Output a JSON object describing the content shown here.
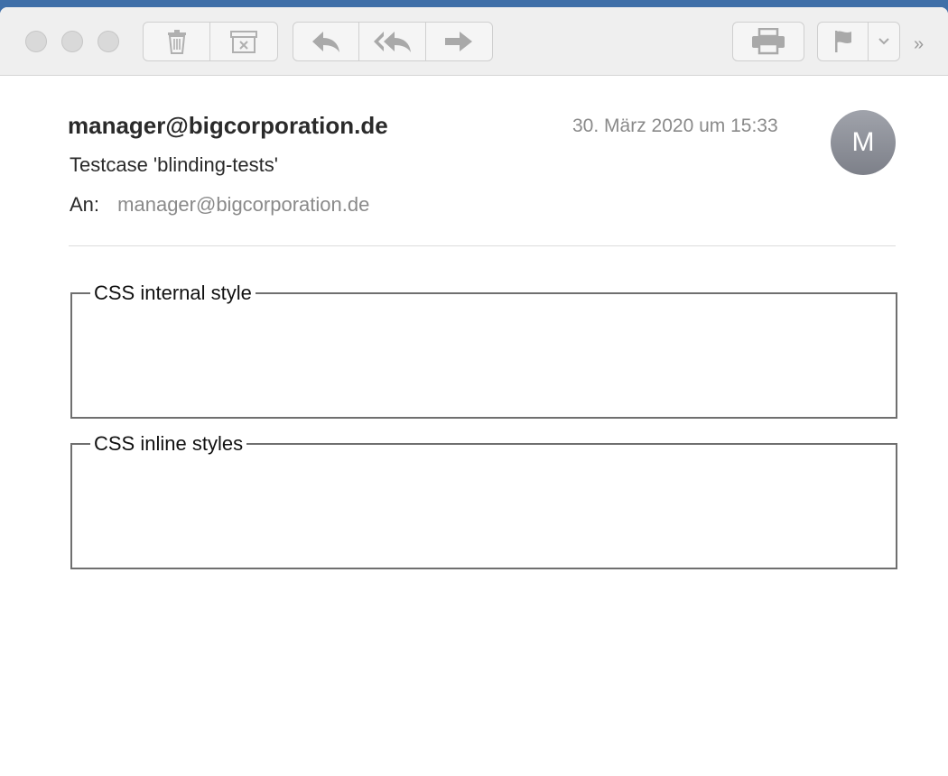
{
  "window": {
    "traffic_lights": [
      "close",
      "minimize",
      "zoom"
    ]
  },
  "toolbar": {
    "icons": {
      "delete": "trash-icon",
      "junk": "junk-icon",
      "reply": "reply-icon",
      "reply_all": "reply-all-icon",
      "forward": "forward-icon",
      "print": "printer-icon",
      "flag": "flag-icon",
      "flag_menu": "chevron-down-icon",
      "more": "double-chevron-right-icon"
    },
    "more_label": "»"
  },
  "message": {
    "sender": "manager@bigcorporation.de",
    "date": "30. März 2020 um 15:33",
    "avatar_initial": "M",
    "subject": "Testcase 'blinding-tests'",
    "to_label": "An:",
    "to_value": "manager@bigcorporation.de"
  },
  "body": {
    "sections": [
      {
        "legend": "CSS internal style"
      },
      {
        "legend": "CSS inline styles"
      }
    ]
  },
  "colors": {
    "toolbar_bg": "#efefef",
    "icon_gray": "#a9a9a9",
    "avatar_top": "#a0a3ab",
    "avatar_bottom": "#7d8089",
    "muted_text": "#8a8a8a"
  }
}
